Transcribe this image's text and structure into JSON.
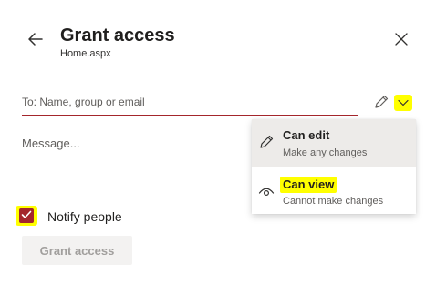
{
  "header": {
    "title": "Grant access",
    "file_name": "Home.aspx",
    "back_icon": "arrow-left-icon",
    "close_icon": "close-icon"
  },
  "recipients": {
    "placeholder": "To: Name, group or email",
    "value": "",
    "permission_icon": "pencil-icon",
    "dropdown_icon": "chevron-down-icon"
  },
  "message": {
    "placeholder": "Message...",
    "value": ""
  },
  "notify": {
    "label": "Notify people",
    "checked": true
  },
  "grant_button": {
    "label": "Grant access",
    "enabled": false
  },
  "permission_menu": {
    "options": [
      {
        "title": "Can edit",
        "description": "Make any changes",
        "icon": "pencil-icon",
        "hovered": true
      },
      {
        "title": "Can view",
        "description": "Cannot make changes",
        "icon": "eye-icon",
        "highlighted": true
      }
    ]
  },
  "colors": {
    "accent_error": "#a4262c",
    "highlight": "#ffff00",
    "disabled_bg": "#f3f2f1",
    "disabled_text": "#a19f9d",
    "hover_bg": "#edebe9"
  }
}
